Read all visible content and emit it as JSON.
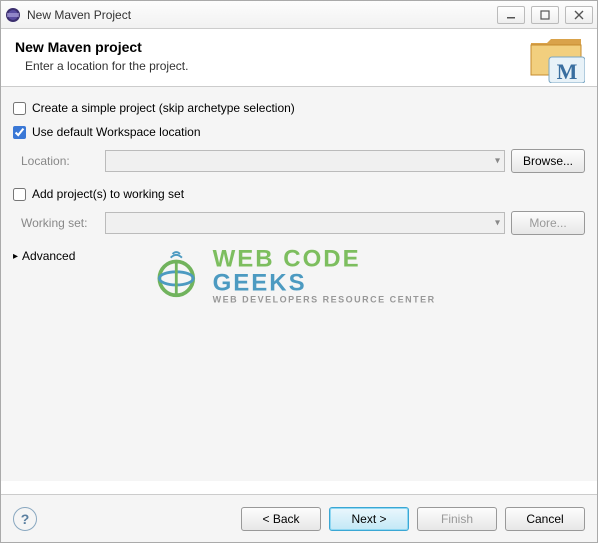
{
  "window": {
    "title": "New Maven Project"
  },
  "banner": {
    "heading": "New Maven project",
    "subtitle": "Enter a location for the project."
  },
  "options": {
    "simple_project": {
      "label": "Create a simple project (skip archetype selection)",
      "checked": false
    },
    "use_default_ws": {
      "label": "Use default Workspace location",
      "checked": true
    },
    "location_label": "Location:",
    "location_value": "",
    "browse_label": "Browse...",
    "add_working_set": {
      "label": "Add project(s) to working set",
      "checked": false
    },
    "working_set_label": "Working set:",
    "working_set_value": "",
    "more_label": "More...",
    "advanced_label": "Advanced"
  },
  "buttons": {
    "back": "< Back",
    "next": "Next >",
    "finish": "Finish",
    "cancel": "Cancel"
  },
  "watermark": {
    "line1a": "WEB CODE ",
    "line1b": "GEEKS",
    "line2": "WEB DEVELOPERS RESOURCE CENTER"
  }
}
